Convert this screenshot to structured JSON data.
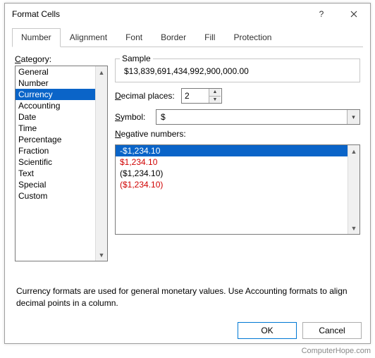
{
  "window": {
    "title": "Format Cells",
    "help_tooltip": "?",
    "close_tooltip": "Close"
  },
  "tabs": [
    {
      "label": "Number",
      "active": true
    },
    {
      "label": "Alignment",
      "active": false
    },
    {
      "label": "Font",
      "active": false
    },
    {
      "label": "Border",
      "active": false
    },
    {
      "label": "Fill",
      "active": false
    },
    {
      "label": "Protection",
      "active": false
    }
  ],
  "category": {
    "label": "Category:",
    "items": [
      "General",
      "Number",
      "Currency",
      "Accounting",
      "Date",
      "Time",
      "Percentage",
      "Fraction",
      "Scientific",
      "Text",
      "Special",
      "Custom"
    ],
    "selected_index": 2
  },
  "sample": {
    "label": "Sample",
    "value": "$13,839,691,434,992,900,000.00"
  },
  "decimals": {
    "label": "Decimal places:",
    "value": "2"
  },
  "symbol": {
    "label": "Symbol:",
    "value": "$"
  },
  "negative": {
    "label": "Negative numbers:",
    "items": [
      {
        "text": "-$1,234.10",
        "color": "black",
        "selected": true
      },
      {
        "text": "$1,234.10",
        "color": "red",
        "selected": false
      },
      {
        "text": "($1,234.10)",
        "color": "black",
        "selected": false
      },
      {
        "text": "($1,234.10)",
        "color": "red",
        "selected": false
      }
    ]
  },
  "description": "Currency formats are used for general monetary values.  Use Accounting formats to align decimal points in a column.",
  "buttons": {
    "ok": "OK",
    "cancel": "Cancel"
  },
  "watermark": "ComputerHope.com"
}
